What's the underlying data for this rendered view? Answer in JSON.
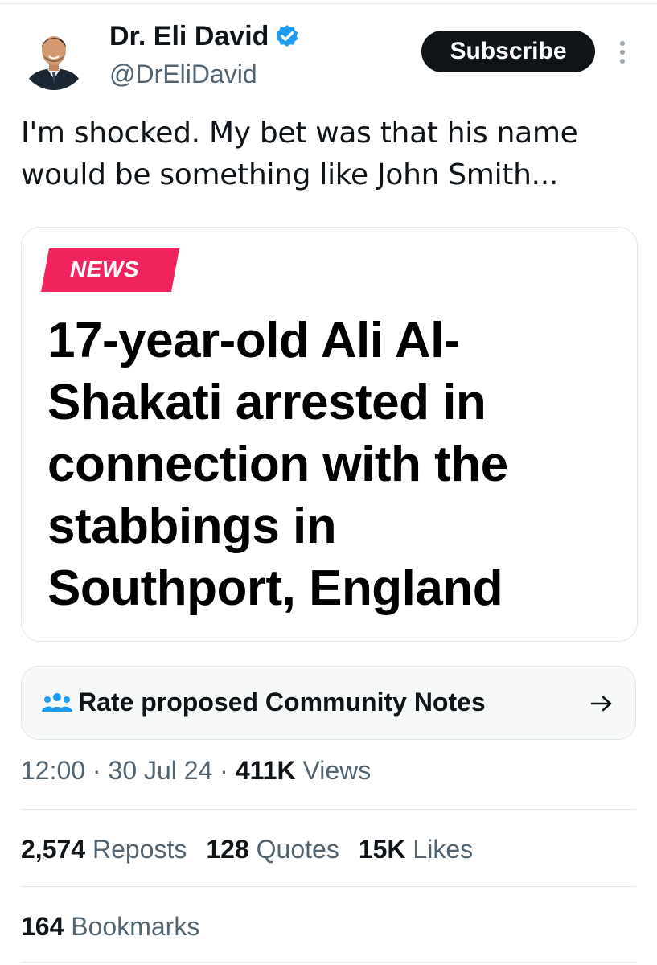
{
  "author": {
    "name": "Dr. Eli David",
    "handle": "@DrEliDavid",
    "verified": true,
    "verified_color": "#1d9bf0"
  },
  "header": {
    "subscribe_label": "Subscribe",
    "more_icon": "more-vertical-icon"
  },
  "tweet": {
    "text_line1": "I'm shocked. My bet was that his name",
    "text_line2": "would be something like John Smith..."
  },
  "media": {
    "tag": "NEWS",
    "tag_color": "#f0245c",
    "headline_lines": [
      "17-year-old Ali Al-",
      "Shakati arrested in",
      "connection with the",
      "stabbings in",
      "Southport, England"
    ]
  },
  "community_notes": {
    "label": "Rate proposed Community Notes",
    "icon": "people-icon",
    "icon_color": "#1d9bf0",
    "arrow_icon": "arrow-right-icon"
  },
  "meta": {
    "time": "12:00",
    "separator": "·",
    "date": "30 Jul 24",
    "views_count": "411K",
    "views_label": "Views"
  },
  "stats": {
    "reposts_count": "2,574",
    "reposts_label": "Reposts",
    "quotes_count": "128",
    "quotes_label": "Quotes",
    "likes_count": "15K",
    "likes_label": "Likes",
    "bookmarks_count": "164",
    "bookmarks_label": "Bookmarks"
  }
}
